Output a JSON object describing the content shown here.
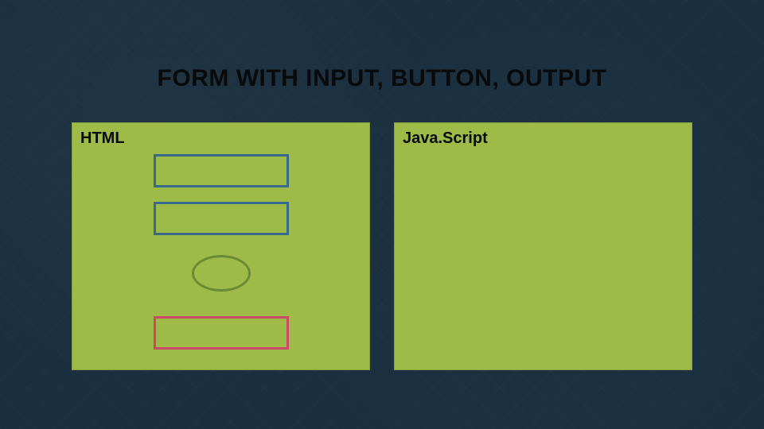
{
  "title": "FORM WITH INPUT, BUTTON, OUTPUT",
  "panels": {
    "left": {
      "label": "HTML"
    },
    "right": {
      "label": "Java.Script"
    }
  }
}
